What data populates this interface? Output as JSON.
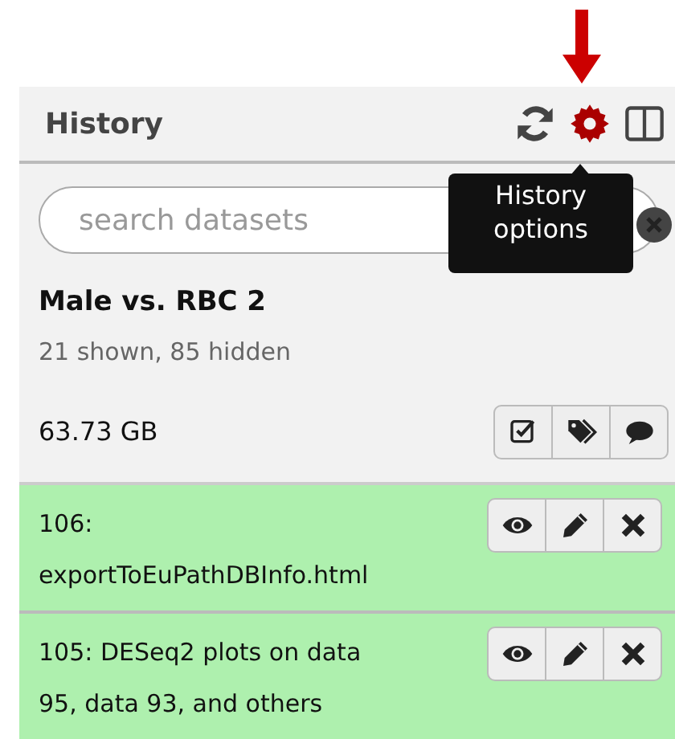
{
  "panel": {
    "title": "History",
    "header_icons": [
      {
        "kind": "refresh",
        "highlighted": false
      },
      {
        "kind": "options",
        "highlighted": true
      },
      {
        "kind": "columns",
        "highlighted": false
      }
    ],
    "tooltip": "History options",
    "search": {
      "placeholder": "search datasets"
    },
    "history_name": "Male vs. RBC 2",
    "counts": "21 shown, 85 hidden",
    "size": "63.73 GB",
    "history_buttons": [
      {
        "kind": "select"
      },
      {
        "kind": "tags"
      },
      {
        "kind": "annotate"
      }
    ],
    "datasets": [
      {
        "label": "106: exportToEuPathDBInfo.html",
        "buttons": [
          {
            "kind": "view"
          },
          {
            "kind": "edit"
          },
          {
            "kind": "delete"
          }
        ]
      },
      {
        "label": "105: DESeq2 plots on data 95, data 93, and others",
        "buttons": [
          {
            "kind": "view"
          },
          {
            "kind": "edit"
          },
          {
            "kind": "delete"
          }
        ]
      }
    ]
  }
}
